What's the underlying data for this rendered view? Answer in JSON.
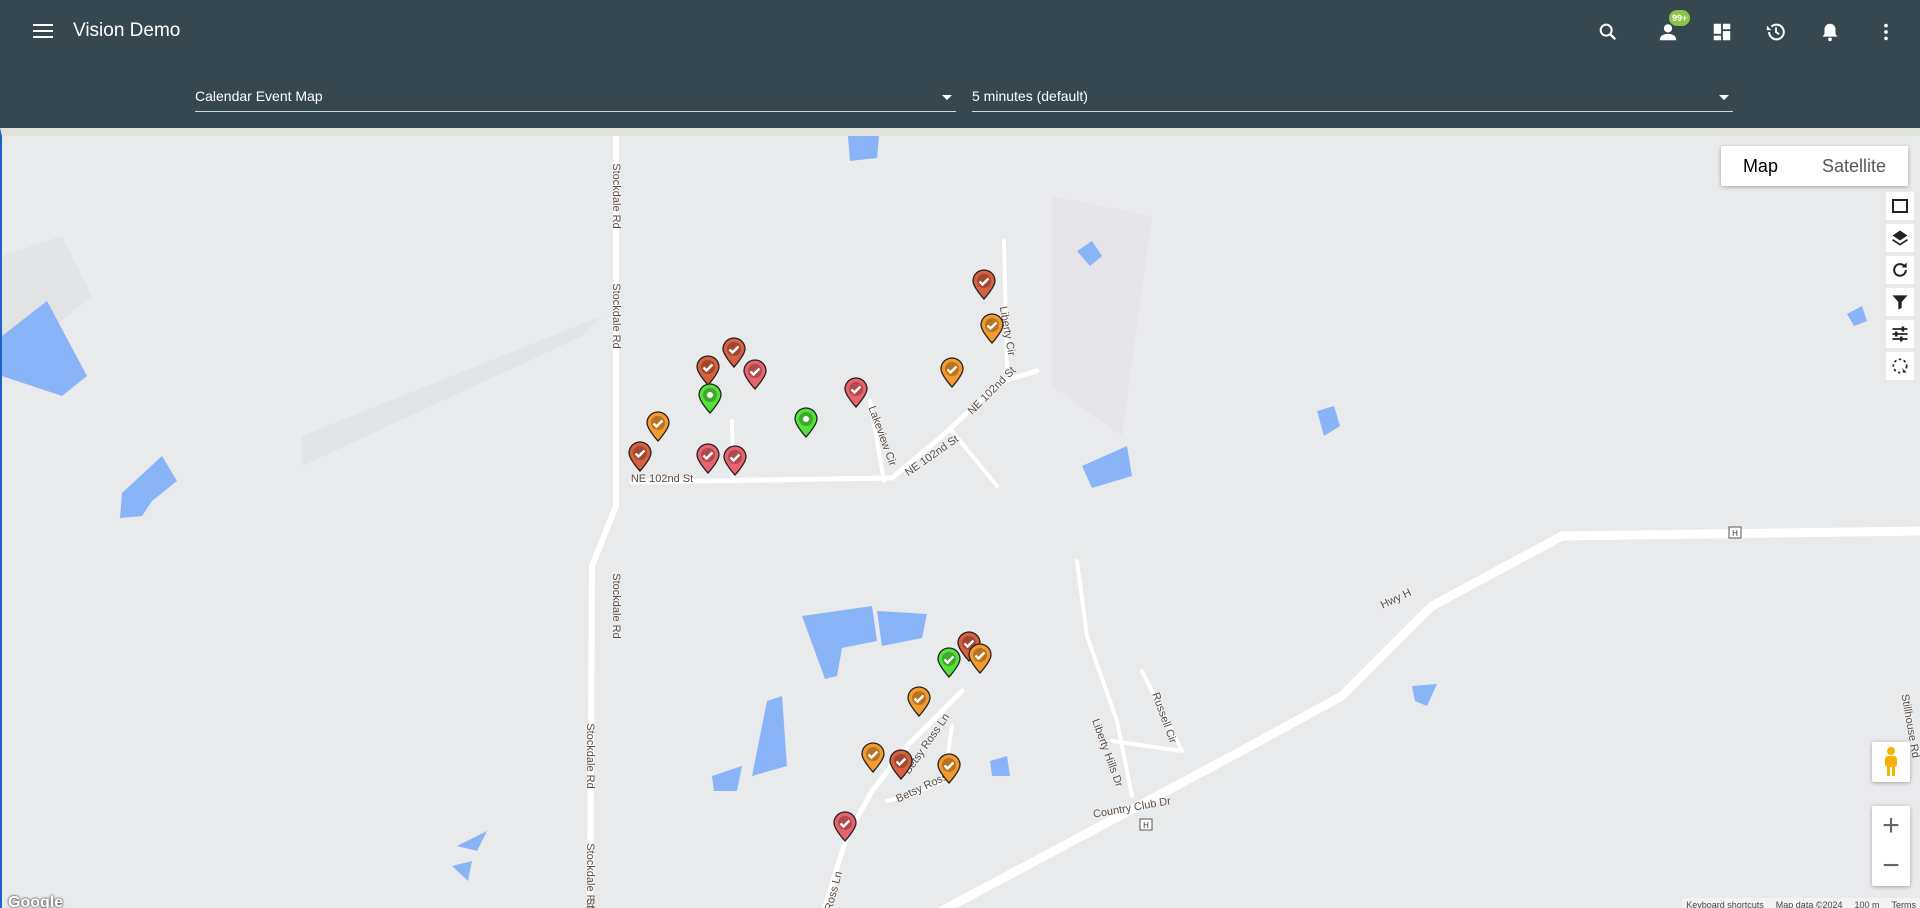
{
  "app": {
    "title": "Vision Demo"
  },
  "header": {
    "icons": [
      "menu-icon",
      "search-icon",
      "user-icon",
      "dashboard-icon",
      "history-icon",
      "bell-icon",
      "more-vert-icon"
    ],
    "user_badge": "99+"
  },
  "filters": {
    "map_select": "Calendar Event Map",
    "interval_select": "5 minutes (default)"
  },
  "map": {
    "type_buttons": {
      "map": "Map",
      "satellite": "Satellite"
    },
    "tools": [
      "square-select-icon",
      "layers-icon",
      "refresh-icon",
      "filter-icon",
      "tune-icon",
      "lasso-select-icon"
    ],
    "zoom_in": "+",
    "zoom_out": "−",
    "logo": "Google",
    "attribution": {
      "shortcuts": "Keyboard shortcuts",
      "map_data": "Map data ©2024",
      "scale": "100 m",
      "terms": "Terms"
    },
    "road_labels": [
      "Stockdale Rd",
      "Stockdale Rd",
      "Stockdale Rd",
      "Stockdale Rd",
      "Stockdale Rd",
      "Sto",
      "NE 102nd St",
      "NE 102nd St",
      "NE 102nd St",
      "Lakeview Cir",
      "Liberty Cir",
      "Hwy H",
      "Betsy Ross Ln",
      "Betsy Ross",
      "Liberty Hills Dr",
      "Russell Cir",
      "Country Club Dr",
      "Stillhouse Rd",
      "H",
      "H",
      "Betsy Ross Ln"
    ],
    "colors": {
      "orange": "#f39b2f",
      "red": "#e8636b",
      "darkred": "#d6603f",
      "green": "#55e03c"
    }
  },
  "markers": [
    {
      "color": "darkred",
      "icon": "check"
    },
    {
      "color": "orange",
      "icon": "check"
    },
    {
      "color": "orange",
      "icon": "check"
    },
    {
      "color": "darkred",
      "icon": "check"
    },
    {
      "color": "darkred",
      "icon": "check"
    },
    {
      "color": "red",
      "icon": "check"
    },
    {
      "color": "green",
      "icon": "dot"
    },
    {
      "color": "orange",
      "icon": "check"
    },
    {
      "color": "red",
      "icon": "check"
    },
    {
      "color": "green",
      "icon": "dot"
    },
    {
      "color": "darkred",
      "icon": "check"
    },
    {
      "color": "red",
      "icon": "check"
    },
    {
      "color": "red",
      "icon": "check"
    },
    {
      "color": "darkred",
      "icon": "check"
    },
    {
      "color": "orange",
      "icon": "check"
    },
    {
      "color": "green",
      "icon": "check"
    },
    {
      "color": "orange",
      "icon": "check"
    },
    {
      "color": "orange",
      "icon": "check"
    },
    {
      "color": "darkred",
      "icon": "check"
    },
    {
      "color": "orange",
      "icon": "check"
    },
    {
      "color": "red",
      "icon": "check"
    }
  ]
}
